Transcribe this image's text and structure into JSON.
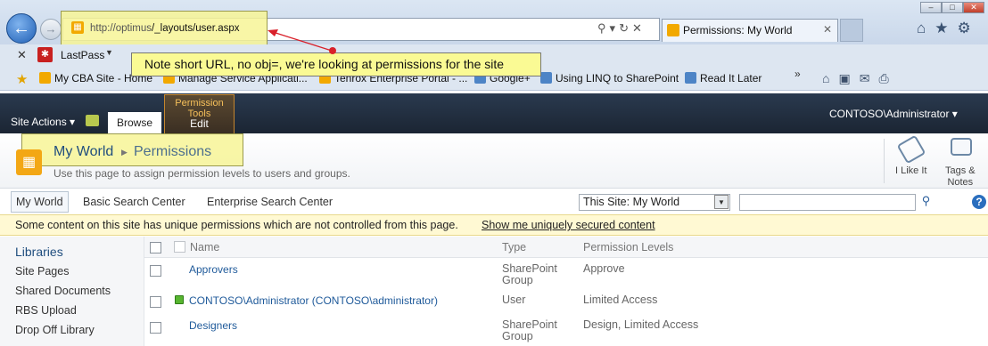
{
  "browser": {
    "url_host": "http://optimus",
    "url_path": "/_layouts/user.aspx",
    "tab_title": "Permissions: My World",
    "tab_close": "✕",
    "toolbar_lastpass": "LastPass",
    "favorites": [
      "My CBA Site - Home",
      "Manage Service Applicati...",
      "Tenrox Enterprise Portal - ...",
      "Google+",
      "Using LINQ to SharePoint",
      "Read It Later"
    ],
    "more_chevron": "»"
  },
  "annotation": {
    "callout_text": "Note short URL, no obj=, we're looking at permissions for the site"
  },
  "ribbon": {
    "site_actions": "Site Actions ▾",
    "tab_browse": "Browse",
    "contextual_group": "Permission Tools",
    "tab_edit": "Edit",
    "user": "CONTOSO\\Administrator ▾"
  },
  "title_area": {
    "site_title": "My World",
    "page_title": "Permissions",
    "description": "Use this page to assign permission levels to users and groups.",
    "like_label": "I Like It",
    "tags_label_1": "Tags &",
    "tags_label_2": "Notes"
  },
  "top_nav": {
    "items": [
      "My World",
      "Basic Search Center",
      "Enterprise Search Center"
    ],
    "scope_value": "This Site: My World"
  },
  "status": {
    "message": "Some content on this site has unique permissions which are not controlled from this page.",
    "link": "Show me uniquely secured content"
  },
  "quick_launch": {
    "heading": "Libraries",
    "items": [
      "Site Pages",
      "Shared Documents",
      "RBS Upload",
      "Drop Off Library"
    ]
  },
  "list": {
    "columns": [
      "Name",
      "Type",
      "Permission Levels"
    ],
    "rows": [
      {
        "name": "Approvers",
        "type_1": "SharePoint",
        "type_2": "Group",
        "levels": "Approve"
      },
      {
        "name": "CONTOSO\\Administrator (CONTOSO\\administrator)",
        "type_1": "User",
        "type_2": "",
        "levels": "Limited Access"
      },
      {
        "name": "Designers",
        "type_1": "SharePoint",
        "type_2": "Group",
        "levels": "Design, Limited Access"
      }
    ]
  }
}
